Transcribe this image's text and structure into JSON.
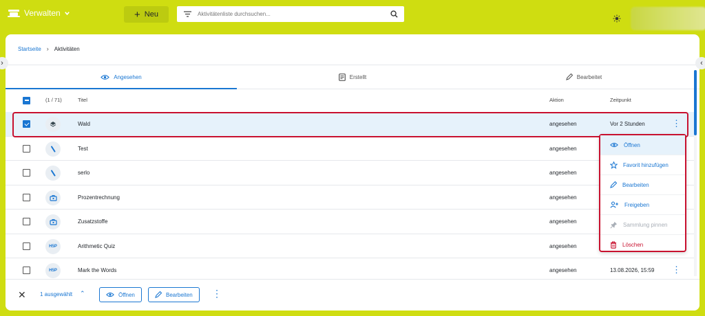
{
  "header": {
    "brand_label": "Verwalten",
    "new_button_label": "Neu",
    "search_placeholder": "Aktivitätenliste durchsuchen..."
  },
  "breadcrumb": {
    "home": "Startseite",
    "current": "Aktivitäten"
  },
  "tabs": [
    {
      "label": "Angesehen",
      "icon": "eye-icon",
      "active": true
    },
    {
      "label": "Erstellt",
      "icon": "document-icon",
      "active": false
    },
    {
      "label": "Bearbeitet",
      "icon": "pencil-icon",
      "active": false
    }
  ],
  "table": {
    "count": "(1 / 71)",
    "columns": {
      "title": "Titel",
      "action": "Aktion",
      "time": "Zeitpunkt"
    },
    "rows": [
      {
        "icon": "layers-icon",
        "icon_text": "",
        "title": "Wald",
        "action": "angesehen",
        "time": "Vor 2 Stunden",
        "checked": true
      },
      {
        "icon": "pen-icon",
        "icon_text": "",
        "title": "Test",
        "action": "angesehen",
        "time": "",
        "checked": false
      },
      {
        "icon": "pen-icon",
        "icon_text": "",
        "title": "serlo",
        "action": "angesehen",
        "time": "",
        "checked": false
      },
      {
        "icon": "toolbox-icon",
        "icon_text": "",
        "title": "Prozentrechnung",
        "action": "angesehen",
        "time": "",
        "checked": false
      },
      {
        "icon": "toolbox-icon",
        "icon_text": "",
        "title": "Zusatzstoffe",
        "action": "angesehen",
        "time": "",
        "checked": false
      },
      {
        "icon": "h5p-icon",
        "icon_text": "H5P",
        "title": "Arithmetic Quiz",
        "action": "angesehen",
        "time": "",
        "checked": false
      },
      {
        "icon": "h5p-icon",
        "icon_text": "H5P",
        "title": "Mark the Words",
        "action": "angesehen",
        "time": "13.08.2026, 15:59",
        "checked": false
      }
    ]
  },
  "context_menu": [
    {
      "label": "Öffnen",
      "icon": "eye-icon",
      "state": "active"
    },
    {
      "label": "Favorit hinzufügen",
      "icon": "star-icon",
      "state": "normal"
    },
    {
      "label": "Bearbeiten",
      "icon": "pencil-icon",
      "state": "normal"
    },
    {
      "label": "Freigeben",
      "icon": "share-user-icon",
      "state": "normal"
    },
    {
      "label": "Sammlung pinnen",
      "icon": "pin-icon",
      "state": "disabled"
    },
    {
      "label": "Löschen",
      "icon": "trash-icon",
      "state": "danger"
    }
  ],
  "bottom_bar": {
    "selected_text": "1 ausgewählt",
    "open_label": "Öffnen",
    "edit_label": "Bearbeiten"
  },
  "colors": {
    "topbar": "#cfdd11",
    "accent": "#1976d2",
    "highlight": "#c8102e"
  }
}
